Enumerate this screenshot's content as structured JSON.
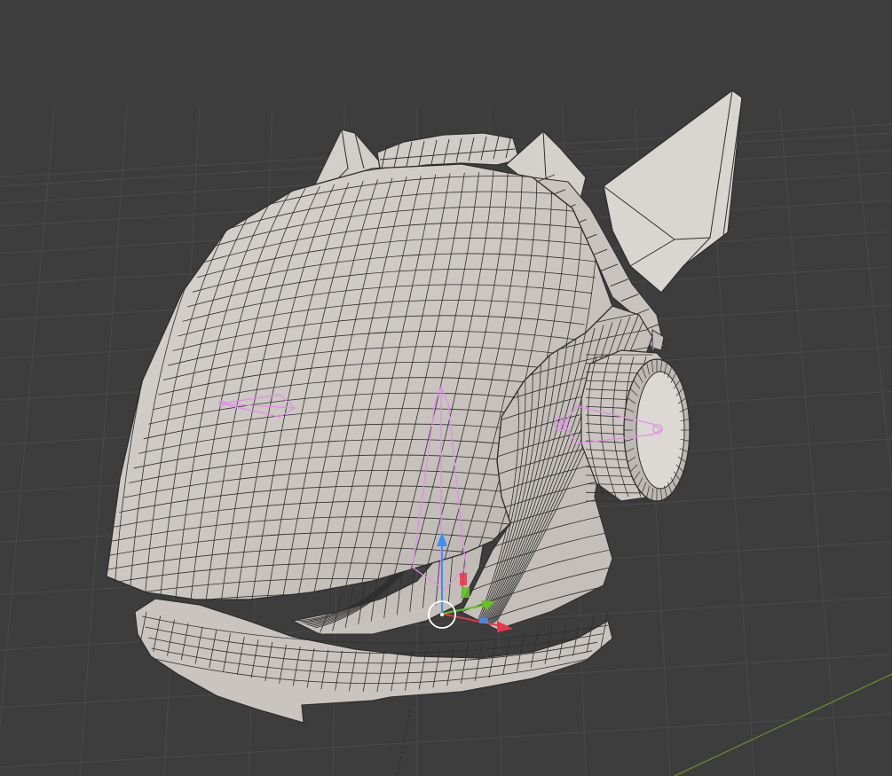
{
  "viewport": {
    "background": "#3d3d3d",
    "grid_color": "#4a4a4a",
    "x_axis_color": "#a33d3d",
    "y_axis_color": "#6d8f2c"
  },
  "model": {
    "object": "helmet-mesh",
    "surface_color": "#cdc9c4",
    "shade_color": "#a9a49f",
    "wire_color": "#2e2e2e"
  },
  "rig": {
    "bone_color": "#e28ee6"
  },
  "gizmo": {
    "type": "move-gizmo",
    "x_color": "#e8374c",
    "y_color": "#63c31e",
    "z_color": "#3f8ff0",
    "pivot_color": "#ffffff"
  }
}
